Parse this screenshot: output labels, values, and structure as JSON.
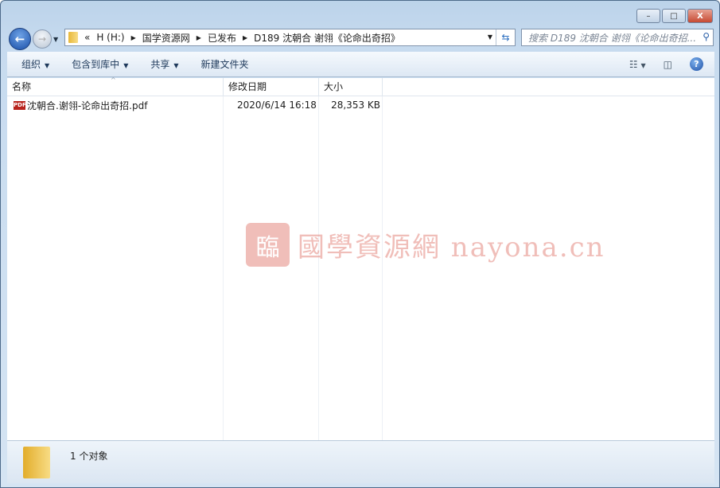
{
  "window": {
    "controls": {
      "minimize": "–",
      "maximize": "□",
      "close": "X"
    }
  },
  "address": {
    "overflow": "«",
    "crumbs": [
      "H (H:)",
      "国学资源网",
      "已发布",
      "D189 沈朝合 谢翎《论命出奇招》"
    ]
  },
  "search": {
    "placeholder": "搜索 D189 沈朝合 谢翎《论命出奇招..."
  },
  "toolbar": {
    "organize": "组织",
    "include": "包含到库中",
    "share": "共享",
    "new_folder": "新建文件夹"
  },
  "columns": {
    "name": "名称",
    "modified": "修改日期",
    "size": "大小"
  },
  "files": [
    {
      "name": "沈朝合.谢翎-论命出奇招.pdf",
      "modified": "2020/6/14 16:18",
      "size": "28,353 KB",
      "icon": "pdf-icon"
    }
  ],
  "watermark": {
    "text": "國學資源網 nayona.cn"
  },
  "status": {
    "count": "1 个对象"
  }
}
